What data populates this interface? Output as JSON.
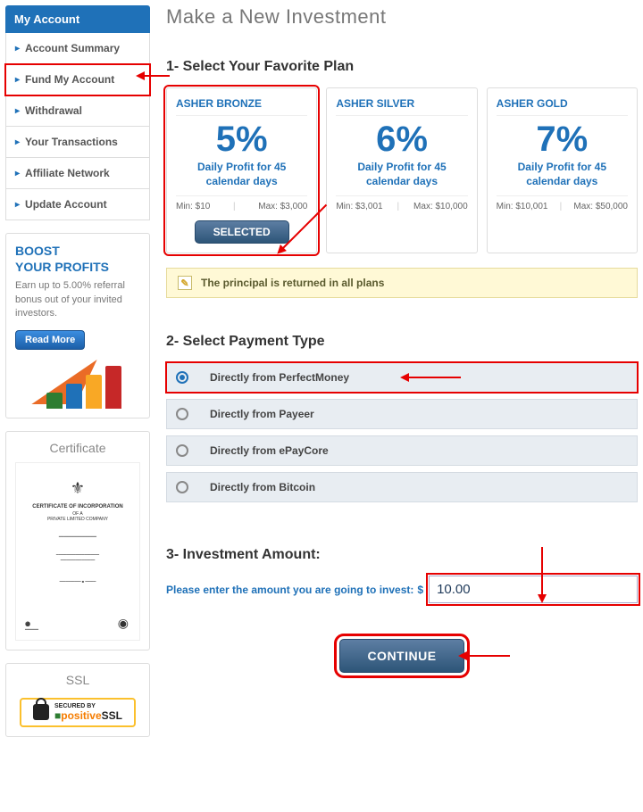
{
  "sidebar": {
    "header": "My Account",
    "items": [
      {
        "label": "Account Summary"
      },
      {
        "label": "Fund My Account"
      },
      {
        "label": "Withdrawal"
      },
      {
        "label": "Your Transactions"
      },
      {
        "label": "Affiliate Network"
      },
      {
        "label": "Update Account"
      }
    ],
    "boost": {
      "title1": "BOOST",
      "title2": "YOUR PROFITS",
      "text": "Earn up to 5.00% referral bonus out of your invited investors.",
      "button": "Read More"
    },
    "certificate": {
      "title": "Certificate"
    },
    "ssl": {
      "title": "SSL",
      "secured": "SECURED BY",
      "brand_pos": "positive",
      "brand_ssl": "SSL"
    }
  },
  "page": {
    "title": "Make a New Investment"
  },
  "section1": {
    "title": "1- Select Your Favorite Plan",
    "plans": [
      {
        "name": "ASHER BRONZE",
        "rate": "5%",
        "desc": "Daily Profit for 45 calendar days",
        "min": "Min: $10",
        "max": "Max: $3,000",
        "selected_label": "SELECTED"
      },
      {
        "name": "ASHER SILVER",
        "rate": "6%",
        "desc": "Daily Profit for 45 calendar days",
        "min": "Min: $3,001",
        "max": "Max: $10,000"
      },
      {
        "name": "ASHER GOLD",
        "rate": "7%",
        "desc": "Daily Profit for 45 calendar days",
        "min": "Min: $10,001",
        "max": "Max: $50,000"
      }
    ],
    "notice": "The principal is returned in all plans"
  },
  "section2": {
    "title": "2- Select Payment Type",
    "options": [
      {
        "label": "Directly from PerfectMoney",
        "checked": true
      },
      {
        "label": "Directly from Payeer",
        "checked": false
      },
      {
        "label": "Directly from ePayCore",
        "checked": false
      },
      {
        "label": "Directly from Bitcoin",
        "checked": false
      }
    ]
  },
  "section3": {
    "title": "3- Investment Amount:",
    "label": "Please enter the amount you are going to invest:",
    "currency": "$",
    "value": "10.00"
  },
  "continue": {
    "label": "CONTINUE"
  }
}
